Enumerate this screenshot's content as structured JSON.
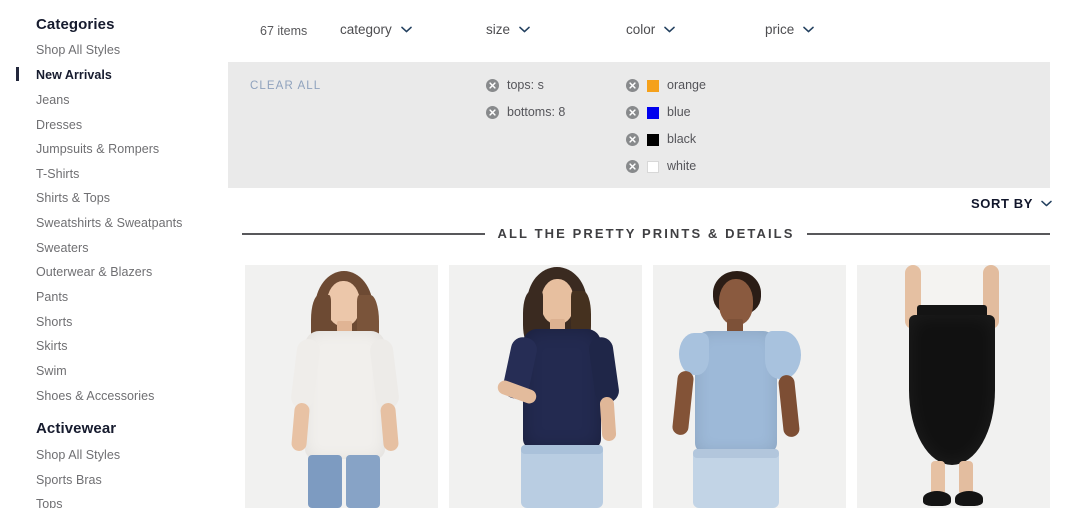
{
  "sidebar": {
    "groups": [
      {
        "heading": "Categories",
        "items": [
          {
            "label": "Shop All Styles",
            "active": false
          },
          {
            "label": "New Arrivals",
            "active": true
          },
          {
            "label": "Jeans",
            "active": false
          },
          {
            "label": "Dresses",
            "active": false
          },
          {
            "label": "Jumpsuits & Rompers",
            "active": false
          },
          {
            "label": "T-Shirts",
            "active": false
          },
          {
            "label": "Shirts & Tops",
            "active": false
          },
          {
            "label": "Sweatshirts & Sweatpants",
            "active": false
          },
          {
            "label": "Sweaters",
            "active": false
          },
          {
            "label": "Outerwear & Blazers",
            "active": false
          },
          {
            "label": "Pants",
            "active": false
          },
          {
            "label": "Shorts",
            "active": false
          },
          {
            "label": "Skirts",
            "active": false
          },
          {
            "label": "Swim",
            "active": false
          },
          {
            "label": "Shoes & Accessories",
            "active": false
          }
        ]
      },
      {
        "heading": "Activewear",
        "items": [
          {
            "label": "Shop All Styles",
            "active": false
          },
          {
            "label": "Sports Bras",
            "active": false
          },
          {
            "label": "Tops",
            "active": false
          }
        ]
      }
    ]
  },
  "filterbar": {
    "item_count": "67 items",
    "dropdowns": [
      {
        "label": "category",
        "icon": "chevron-down-icon"
      },
      {
        "label": "size",
        "icon": "chevron-down-icon"
      },
      {
        "label": "color",
        "icon": "chevron-down-icon"
      },
      {
        "label": "price",
        "icon": "chevron-down-icon"
      }
    ]
  },
  "filter_panel": {
    "clear_all_label": "CLEAR ALL",
    "background": "#eaeaea",
    "size_chips": [
      {
        "label": "tops: s",
        "icon": "remove-circle-icon"
      },
      {
        "label": "bottoms: 8",
        "icon": "remove-circle-icon"
      }
    ],
    "color_chips": [
      {
        "label": "orange",
        "swatch": "#f5a11b",
        "icon": "remove-circle-icon"
      },
      {
        "label": "blue",
        "swatch": "#0000ee",
        "icon": "remove-circle-icon"
      },
      {
        "label": "black",
        "swatch": "#000000",
        "icon": "remove-circle-icon"
      },
      {
        "label": "white",
        "swatch": "#ffffff",
        "icon": "remove-circle-icon"
      }
    ]
  },
  "sort": {
    "label": "SORT BY",
    "icon": "chevron-down-icon"
  },
  "section": {
    "title": "ALL THE PRETTY PRINTS & DETAILS"
  },
  "products": [
    {
      "alt": "Model wearing white eyelet square-neck top with jeans",
      "garment": "#f0efed",
      "hair": "#6d4a33",
      "skin": "#e8c3a6",
      "bottom": "#7d9bc1"
    },
    {
      "alt": "Model wearing navy eyelet square-neck top with light jeans",
      "garment": "#232a50",
      "hair": "#3a2a20",
      "skin": "#e3bb9c",
      "bottom": "#b9cde2"
    },
    {
      "alt": "Model wearing blue floral flutter-sleeve top with jeans",
      "garment": "#9db9d8",
      "hair": "#2b1d16",
      "skin": "#8a5a३f",
      "bottom": "#c2d4e6"
    },
    {
      "alt": "Model wearing black eyelet midi skirt with flats",
      "garment": "#f4f3f1",
      "hair": "#2b1d16",
      "skin": "#e5c0a2",
      "bottom": "#111111"
    }
  ]
}
